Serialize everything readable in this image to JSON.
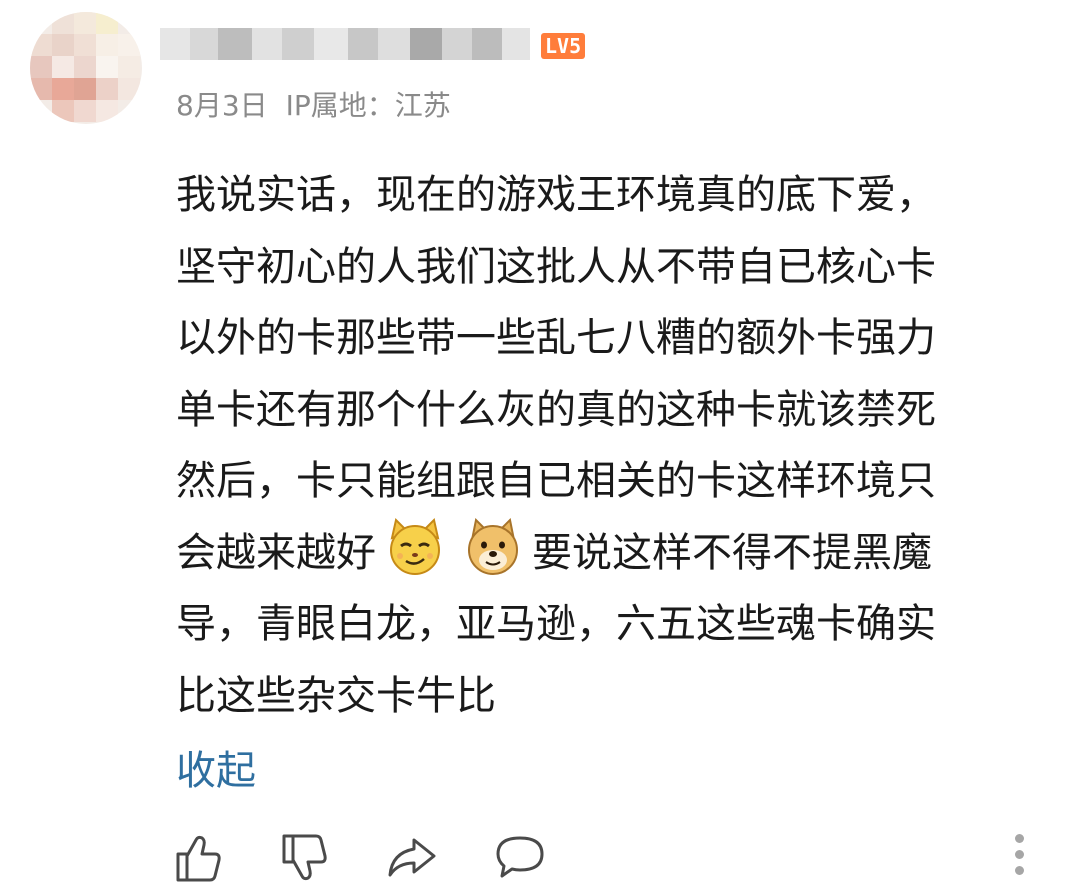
{
  "comment": {
    "author": {
      "level_badge": "LV5"
    },
    "meta": {
      "date": "8月3日",
      "ip_location": "IP属地：江苏"
    },
    "body_lines": [
      "我说实话，现在的游戏王环境真的底下爱，",
      "坚守初心的人我们这批人从不带自已核心卡",
      "以外的卡那些带一些乱七八糟的额外卡强力",
      "单卡还有那个什么灰的真的这种卡就该禁死",
      "然后，卡只能组跟自已相关的卡这样环境只",
      "会越来越好",
      "要说这样不得不提黑魔",
      "导，青眼白龙，亚马逊，六五这些魂卡确实",
      "比这些杂交卡牛比"
    ],
    "emojis": [
      "smirking-cat-emoji",
      "doge-emoji"
    ],
    "collapse_label": "收起"
  },
  "actions": {
    "icons": [
      "thumbs-up-icon",
      "thumbs-down-icon",
      "share-icon",
      "comment-icon",
      "more-vertical-icon"
    ]
  },
  "colors": {
    "text": "#1a1a1a",
    "meta": "#8a8a8a",
    "link": "#2f6fa0",
    "badge": "#ff7d3b",
    "icon": "#4a4a4a"
  }
}
